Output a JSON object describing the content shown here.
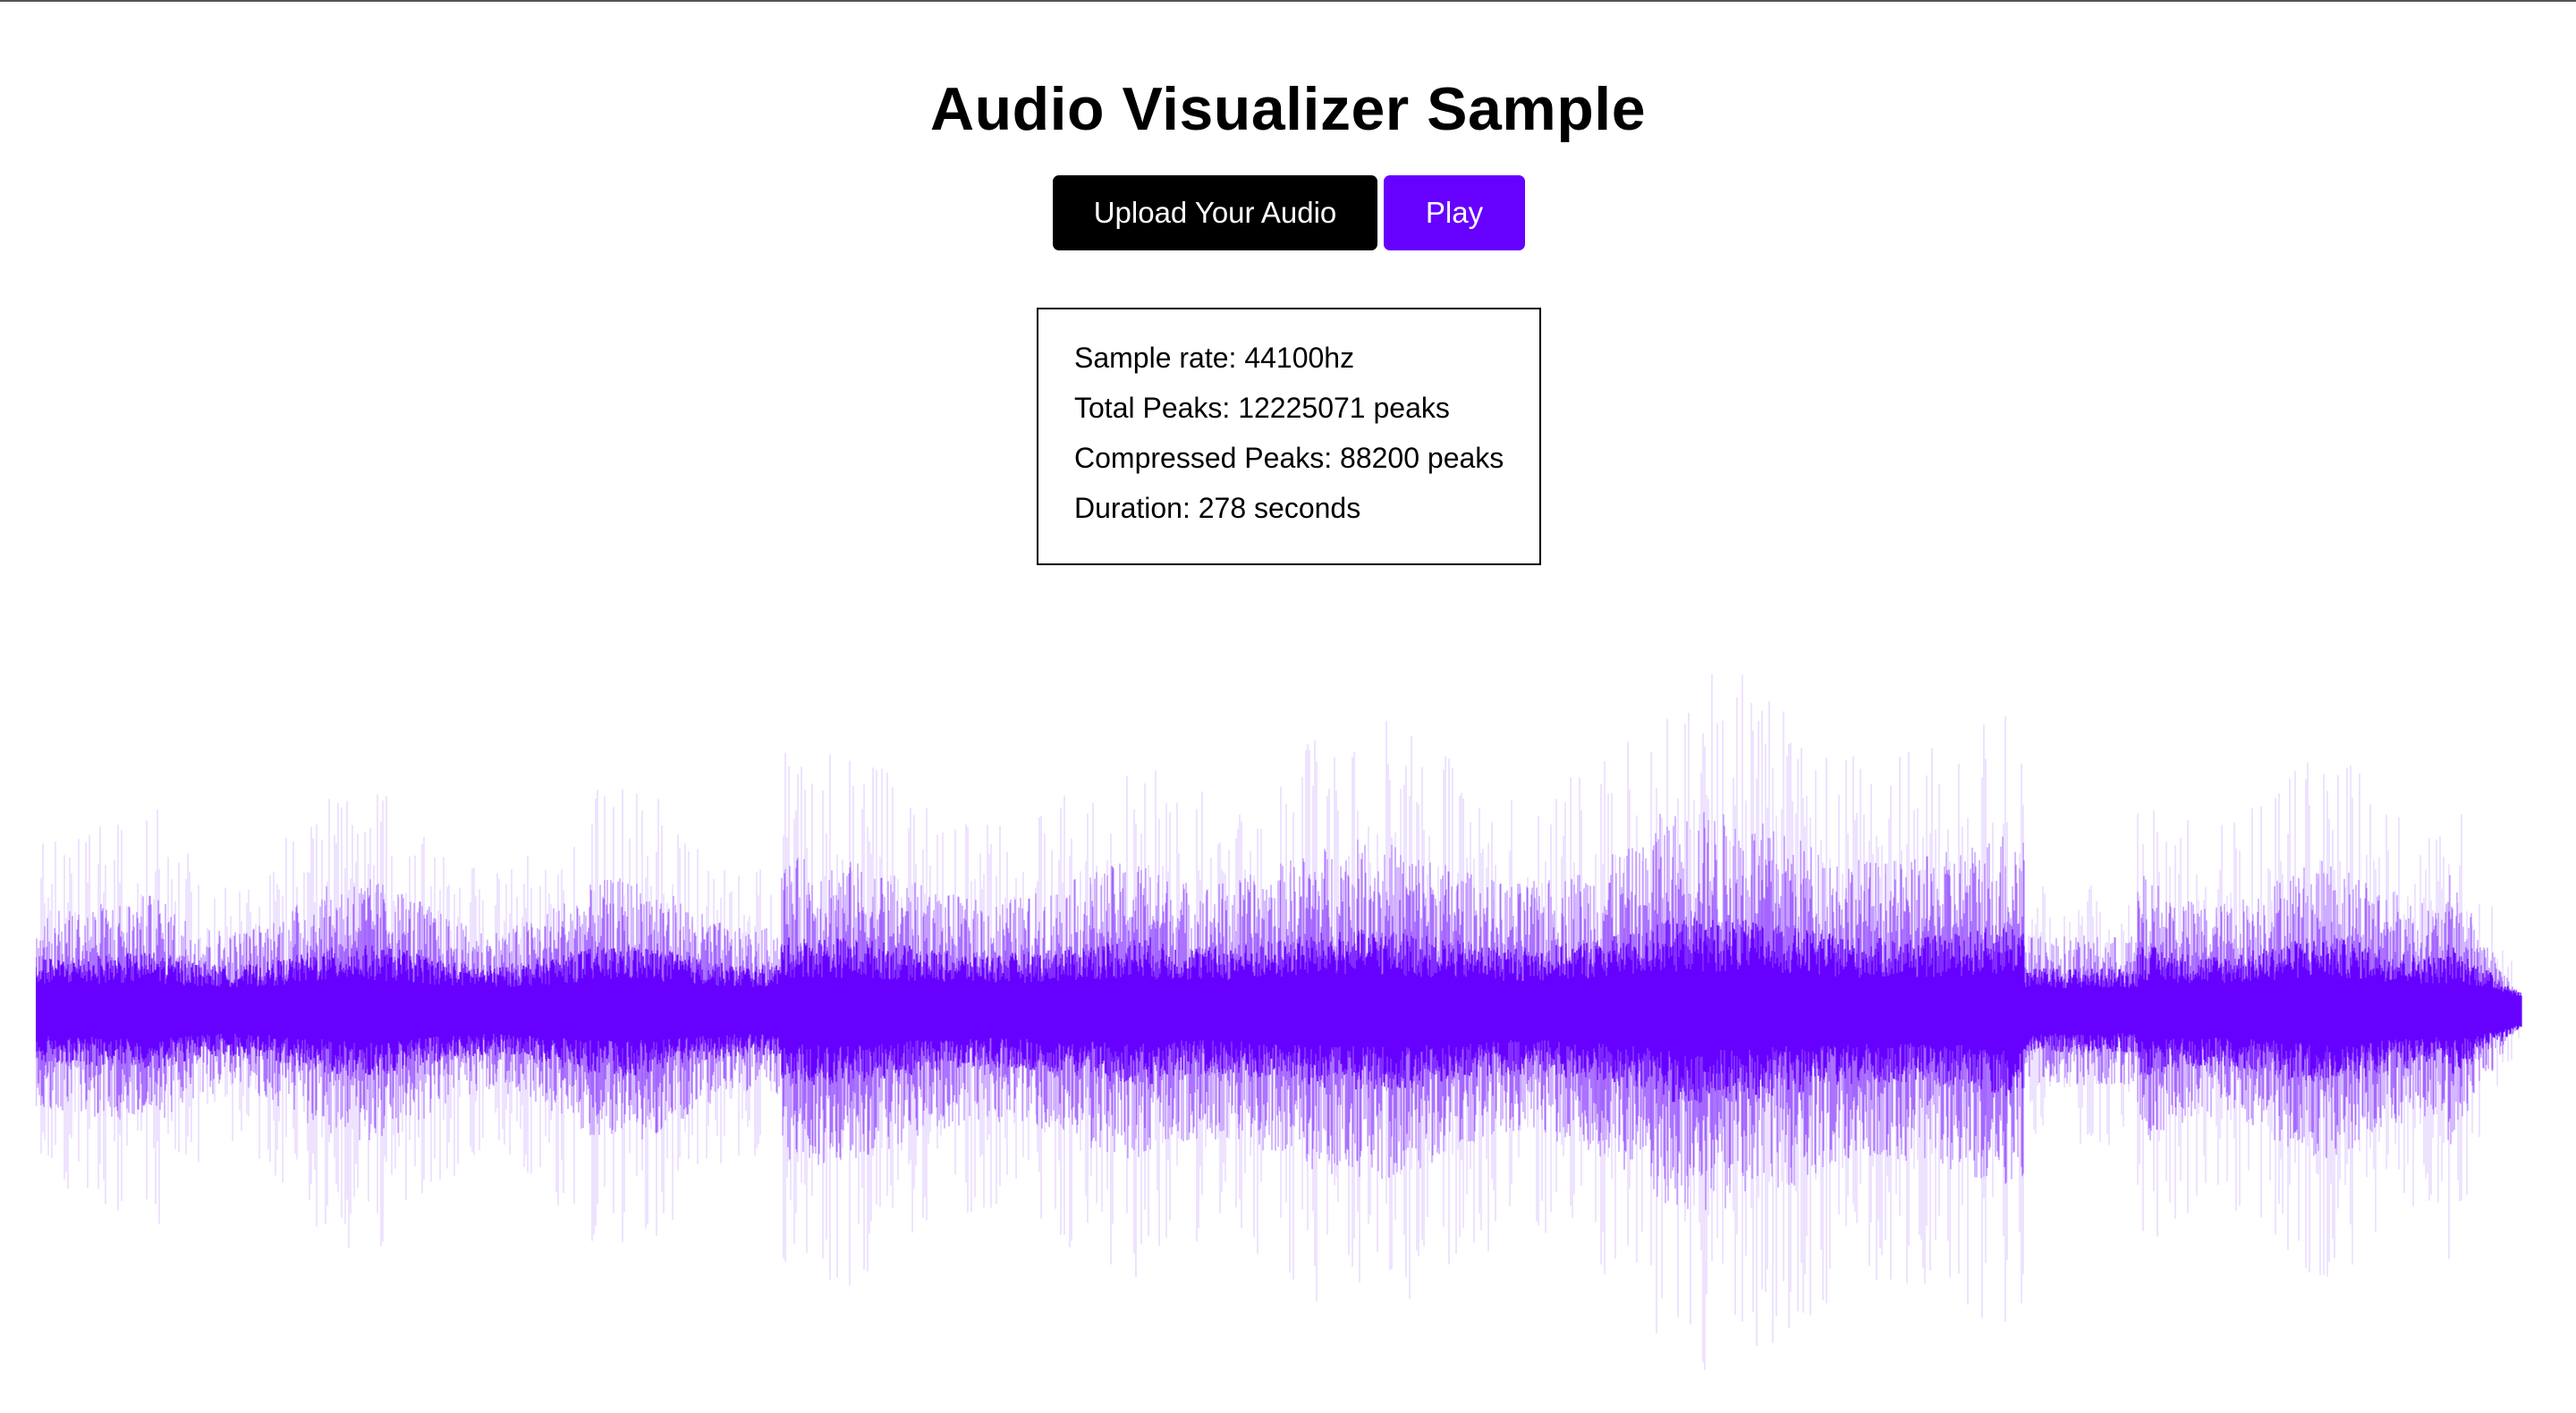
{
  "page": {
    "title": "Audio Visualizer Sample"
  },
  "controls": {
    "upload_label": "Upload Your Audio",
    "play_label": "Play"
  },
  "info": {
    "sample_rate": "Sample rate: 44100hz",
    "total_peaks": "Total Peaks: 12225071 peaks",
    "compressed_peaks": "Compressed Peaks: 88200 peaks",
    "duration": "Duration: 278 seconds"
  },
  "waveform": {
    "color": "#6600ff",
    "duration_seconds": 278,
    "compressed_peaks": 88200
  },
  "colors": {
    "accent": "#6600ff",
    "upload_button": "#000000",
    "text": "#000000",
    "background": "#ffffff"
  }
}
